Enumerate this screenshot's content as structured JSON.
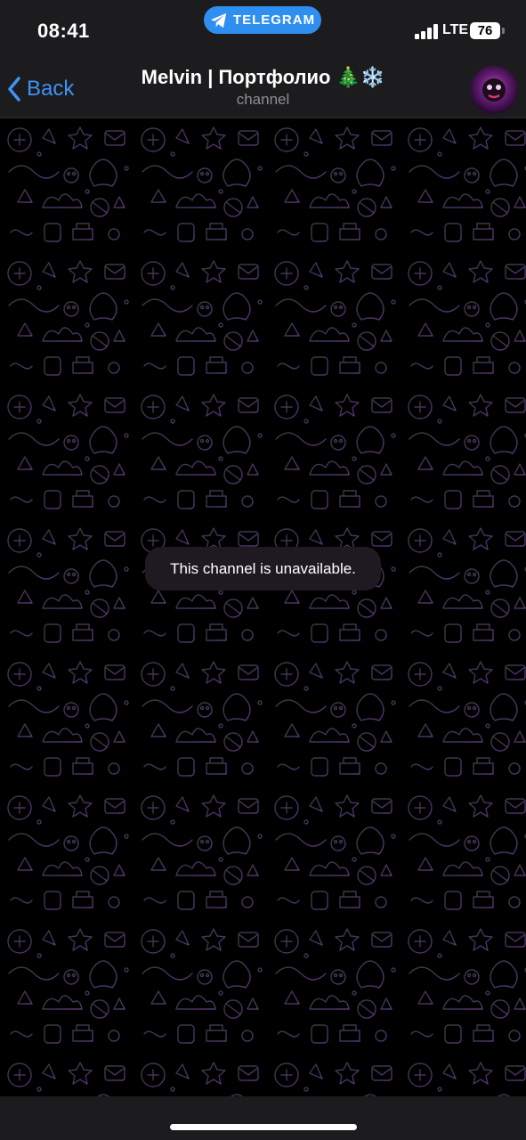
{
  "status_bar": {
    "time": "08:41",
    "app_pill": {
      "label": "TELEGRAM",
      "icon": "telegram-plane-icon",
      "color": "#2f8ff0"
    },
    "network": "LTE",
    "battery": "76"
  },
  "nav": {
    "back_label": "Back",
    "title": "Melvin | Портфолио 🎄❄️",
    "subtitle": "channel",
    "accent": "#3f93f5"
  },
  "chat": {
    "notice": "This channel is unavailable."
  }
}
